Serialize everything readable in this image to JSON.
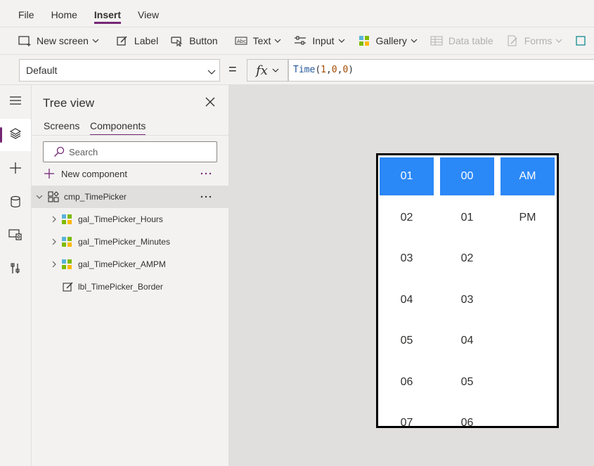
{
  "menu": {
    "items": [
      "File",
      "Home",
      "Insert",
      "View"
    ],
    "active": "Insert"
  },
  "ribbon": {
    "new_screen": "New screen",
    "label": "Label",
    "button": "Button",
    "text": "Text",
    "input": "Input",
    "gallery": "Gallery",
    "data_table": "Data table",
    "forms": "Forms"
  },
  "formula": {
    "property": "Default",
    "equals": "=",
    "fx": "fx",
    "fn_name": "Time",
    "open": "(",
    "arg1": "1",
    "comma1": ",",
    "arg2": "0",
    "comma2": ",",
    "arg3": "0",
    "close": ")"
  },
  "tree": {
    "title": "Tree view",
    "tabs": {
      "screens": "Screens",
      "components": "Components"
    },
    "search_placeholder": "Search",
    "new_component": "New component",
    "root": "cmp_TimePicker",
    "children": [
      "gal_TimePicker_Hours",
      "gal_TimePicker_Minutes",
      "gal_TimePicker_AMPM",
      "lbl_TimePicker_Border"
    ]
  },
  "picker": {
    "hours": [
      "01",
      "02",
      "03",
      "04",
      "05",
      "06",
      "07"
    ],
    "minutes": [
      "00",
      "01",
      "02",
      "03",
      "04",
      "05",
      "06"
    ],
    "ampm": [
      "AM",
      "PM"
    ],
    "selected_color": "#2B88F7"
  },
  "colors": {
    "accent": "#742774",
    "selection": "#2B88F7"
  }
}
